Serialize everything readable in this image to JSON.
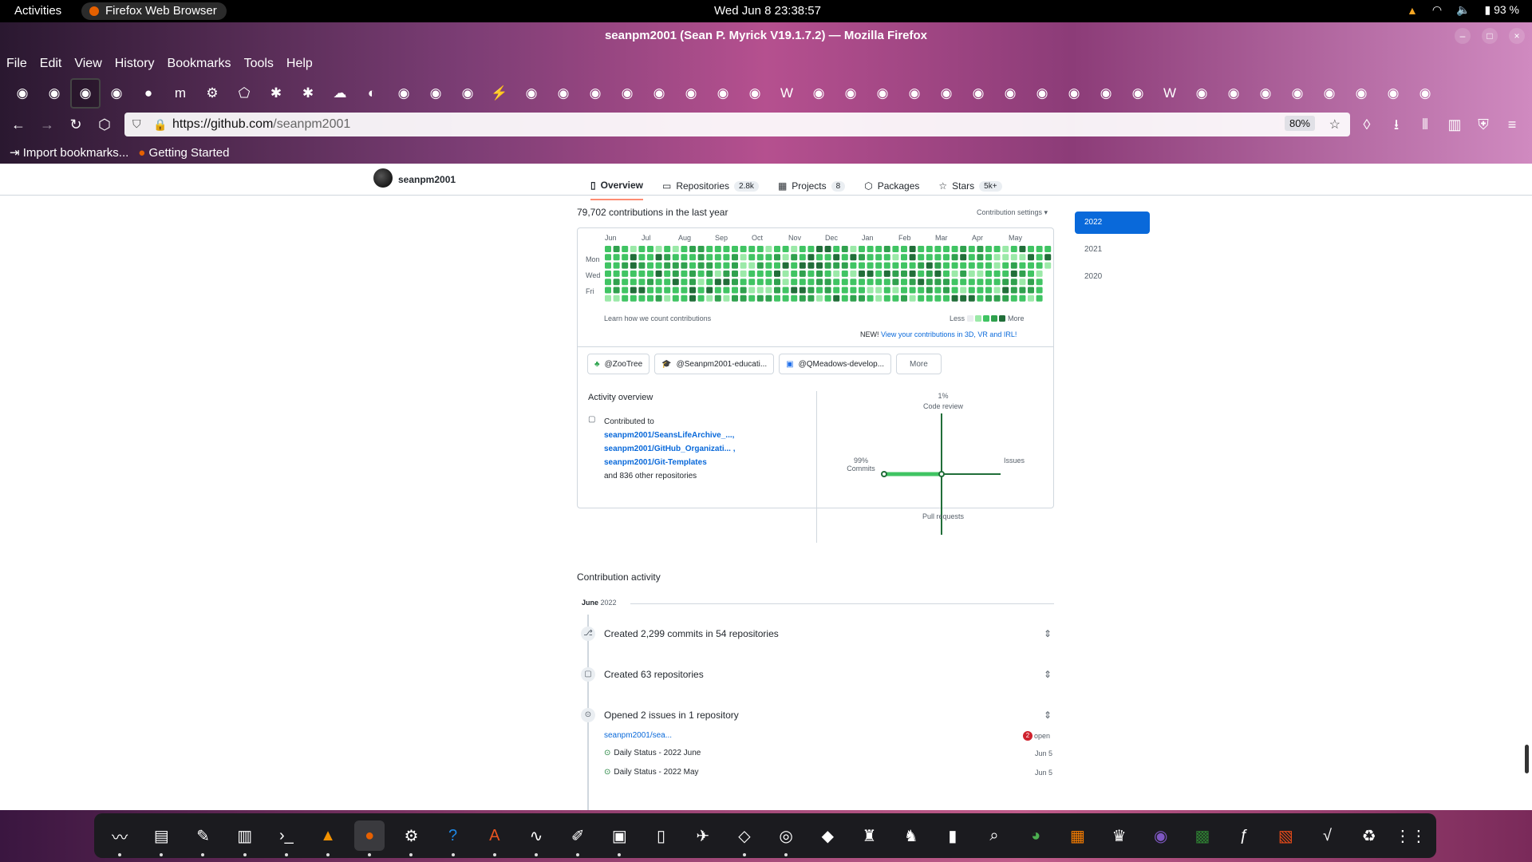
{
  "system": {
    "activities": "Activities",
    "app_name": "Firefox Web Browser",
    "clock": "Wed Jun 8  23:38:57",
    "battery": "93 %"
  },
  "browser": {
    "window_title": "seanpm2001 (Sean P. Myrick V19.1.7.2) — Mozilla Firefox",
    "menu": [
      "File",
      "Edit",
      "View",
      "History",
      "Bookmarks",
      "Tools",
      "Help"
    ],
    "url_domain": "https://github.com",
    "url_path": "/seanpm2001",
    "zoom": "80%",
    "bookmarks": [
      "Import bookmarks...",
      "Getting Started"
    ],
    "tab_icons": [
      "github",
      "github",
      "github",
      "github",
      "firefox",
      "medium",
      "gear",
      "puzzle",
      "snowflake",
      "snowflake",
      "cloud",
      "ddg",
      "github",
      "github",
      "github",
      "wand",
      "github",
      "github",
      "github",
      "github",
      "github",
      "github",
      "github",
      "github",
      "wikipedia",
      "github",
      "github",
      "github",
      "github",
      "github",
      "github",
      "github",
      "github",
      "github",
      "github",
      "github",
      "wikipedia",
      "github",
      "github",
      "github",
      "github",
      "github",
      "github",
      "github",
      "github"
    ]
  },
  "profile": {
    "username": "seanpm2001",
    "tabs": [
      {
        "label": "Overview",
        "count": ""
      },
      {
        "label": "Repositories",
        "count": "2.8k"
      },
      {
        "label": "Projects",
        "count": "8"
      },
      {
        "label": "Packages",
        "count": ""
      },
      {
        "label": "Stars",
        "count": "5k+"
      }
    ]
  },
  "contrib": {
    "title": "79,702 contributions in the last year",
    "settings": "Contribution settings ▾",
    "months": [
      "Jun",
      "Jul",
      "Aug",
      "Sep",
      "Oct",
      "Nov",
      "Dec",
      "Jan",
      "Feb",
      "Mar",
      "Apr",
      "May"
    ],
    "days": [
      "Mon",
      "Wed",
      "Fri"
    ],
    "learn": "Learn how we count contributions",
    "less": "Less",
    "more": "More",
    "new_label": "NEW!",
    "new_link": "View your contributions in 3D, VR and IRL!"
  },
  "years": [
    "2022",
    "2021",
    "2020"
  ],
  "orgs": [
    "@ZooTree",
    "@Seanpm2001-educati...",
    "@QMeadows-develop...",
    "More"
  ],
  "activity": {
    "heading": "Activity overview",
    "contributed_to": "Contributed to",
    "repos": [
      "seanpm2001/SeansLifeArchive_...,",
      "seanpm2001/GitHub_Organizati... ,",
      "seanpm2001/Git-Templates"
    ],
    "other": "and 836 other repositories",
    "chart": {
      "code_review_pct": "1%",
      "code_review": "Code review",
      "commits_pct": "99%",
      "commits": "Commits",
      "issues": "Issues",
      "pull_requests": "Pull requests"
    }
  },
  "timeline": {
    "heading": "Contribution activity",
    "month": "June",
    "year": "2022",
    "items": [
      "Created 2,299 commits in 54 repositories",
      "Created 63 repositories",
      "Opened 2 issues in 1 repository"
    ],
    "issue_repo": "seanpm2001/sea...",
    "issue_count": "2",
    "issue_state": "open",
    "issues": [
      {
        "title": "Daily Status - 2022 June",
        "date": "Jun 5"
      },
      {
        "title": "Daily Status - 2022 May",
        "date": "Jun 5"
      }
    ]
  },
  "dock": [
    "system-monitor",
    "files",
    "text-editor",
    "notes",
    "terminal",
    "vlc",
    "firefox",
    "settings",
    "help",
    "app-center",
    "waveform",
    "writer",
    "mixer",
    "document",
    "reaper",
    "virtualbox",
    "disk",
    "inkscape",
    "car",
    "mario",
    "archive",
    "viewer",
    "chrome",
    "pdf",
    "steam-like",
    "obs",
    "calc",
    "filezilla",
    "impress",
    "math",
    "trash",
    "app-grid"
  ],
  "colors": {
    "accent": "#0969da",
    "green_levels": [
      "#ebedf0",
      "#9be9a8",
      "#40c463",
      "#30a14e",
      "#216e39"
    ]
  }
}
